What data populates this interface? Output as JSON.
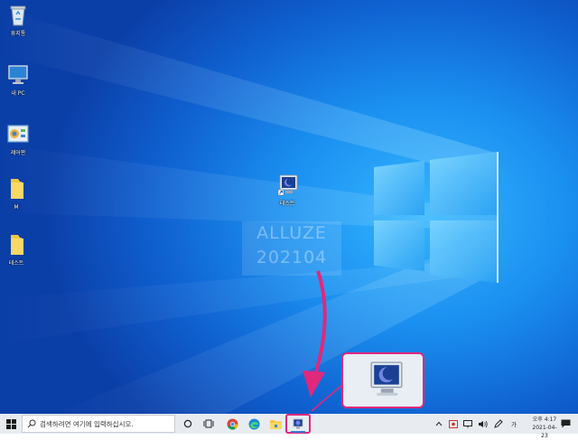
{
  "desktop": {
    "icons": [
      {
        "label": "휴지통",
        "icon": "recycle-bin-icon"
      },
      {
        "label": "내 PC",
        "icon": "computer-icon"
      },
      {
        "label": "제어판",
        "icon": "control-panel-icon"
      },
      {
        "label": "M",
        "icon": "folder-icon"
      },
      {
        "label": "테스트",
        "icon": "folder-icon"
      },
      {
        "label": "테스트",
        "icon": "monitor-shortcut-icon"
      }
    ],
    "watermark": [
      "ALLUZE",
      "202104"
    ],
    "accent": "#e0287d"
  },
  "taskbar": {
    "search_placeholder": "검색하려면 여기에 입력하십시오.",
    "ime_indicator": "가",
    "clock": {
      "time": "오후 4:17",
      "date": "2021-04-23"
    },
    "pinned": [
      "task-view-icon",
      "chrome-icon",
      "edge-icon",
      "file-explorer-icon",
      "monitor-shortcut-icon"
    ]
  }
}
